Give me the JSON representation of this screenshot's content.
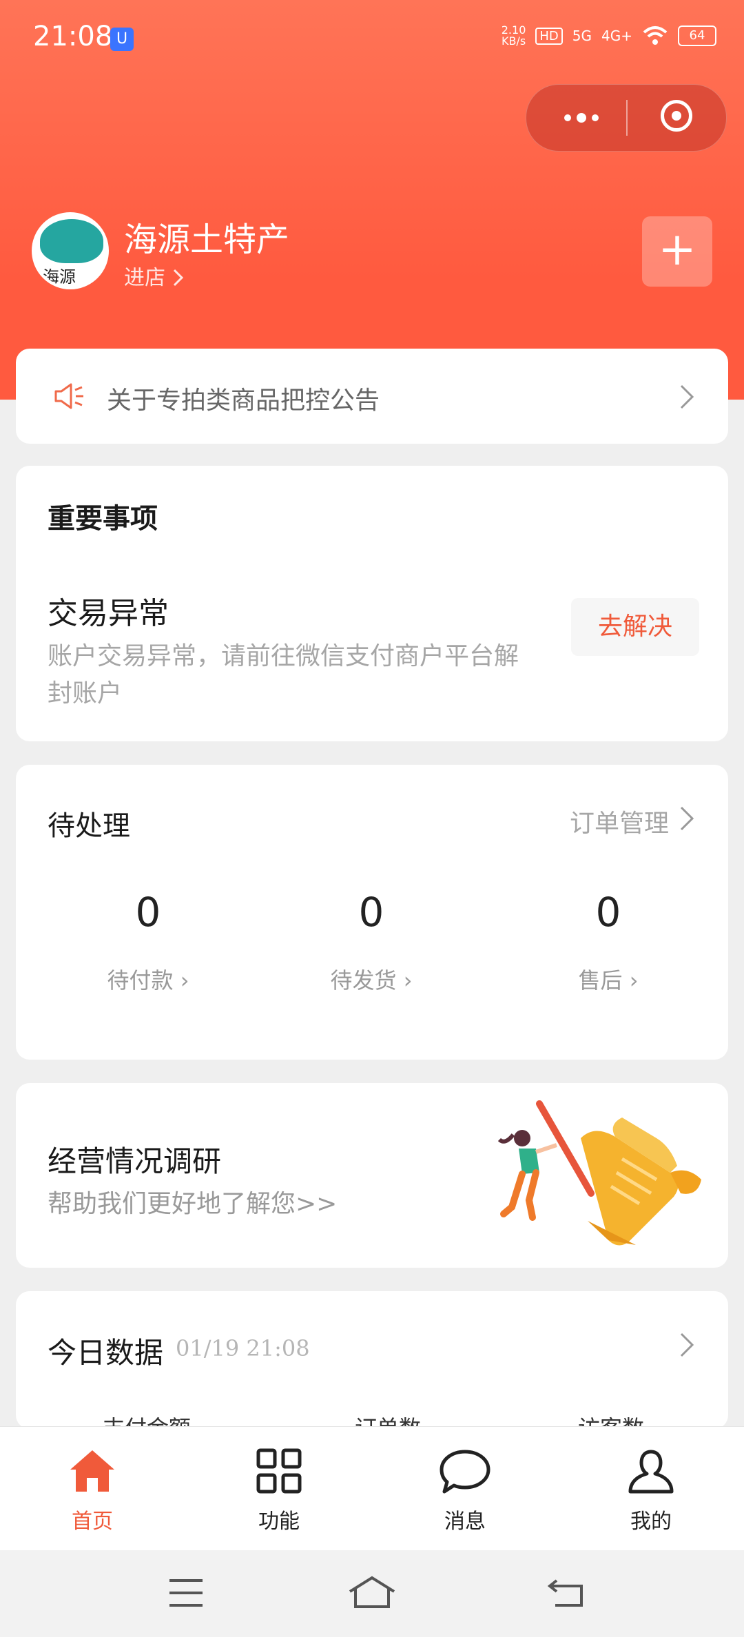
{
  "status_bar": {
    "time": "21:08",
    "badge": "U",
    "net_speed_value": "2.10",
    "net_speed_unit": "KB/s",
    "hd": "HD",
    "sig1": "5G",
    "sig2": "4G+",
    "battery": "64"
  },
  "shop": {
    "name": "海源土特产",
    "enter": "进店",
    "avatar_text": "海源",
    "add_label": "+"
  },
  "notice": {
    "text": "关于专拍类商品把控公告"
  },
  "important": {
    "title": "重要事项",
    "item_title": "交易异常",
    "item_desc": "账户交易异常，请前往微信支付商户平台解封账户",
    "button": "去解决"
  },
  "pending": {
    "title": "待处理",
    "link": "订单管理",
    "stats": [
      {
        "value": "0",
        "label": "待付款"
      },
      {
        "value": "0",
        "label": "待发货"
      },
      {
        "value": "0",
        "label": "售后"
      }
    ]
  },
  "survey": {
    "title": "经营情况调研",
    "subtitle": "帮助我们更好地了解您>>"
  },
  "today": {
    "title": "今日数据",
    "datetime": "01/19 21:08",
    "columns": [
      "支付金额",
      "订单数",
      "访客数"
    ]
  },
  "tabs": [
    {
      "label": "首页",
      "icon": "home-icon",
      "active": true
    },
    {
      "label": "功能",
      "icon": "grid-icon",
      "active": false
    },
    {
      "label": "消息",
      "icon": "chat-bubble-icon",
      "active": false
    },
    {
      "label": "我的",
      "icon": "person-icon",
      "active": false
    }
  ],
  "colors": {
    "brand": "#ff5a3f",
    "accent_text": "#f05a3a"
  }
}
